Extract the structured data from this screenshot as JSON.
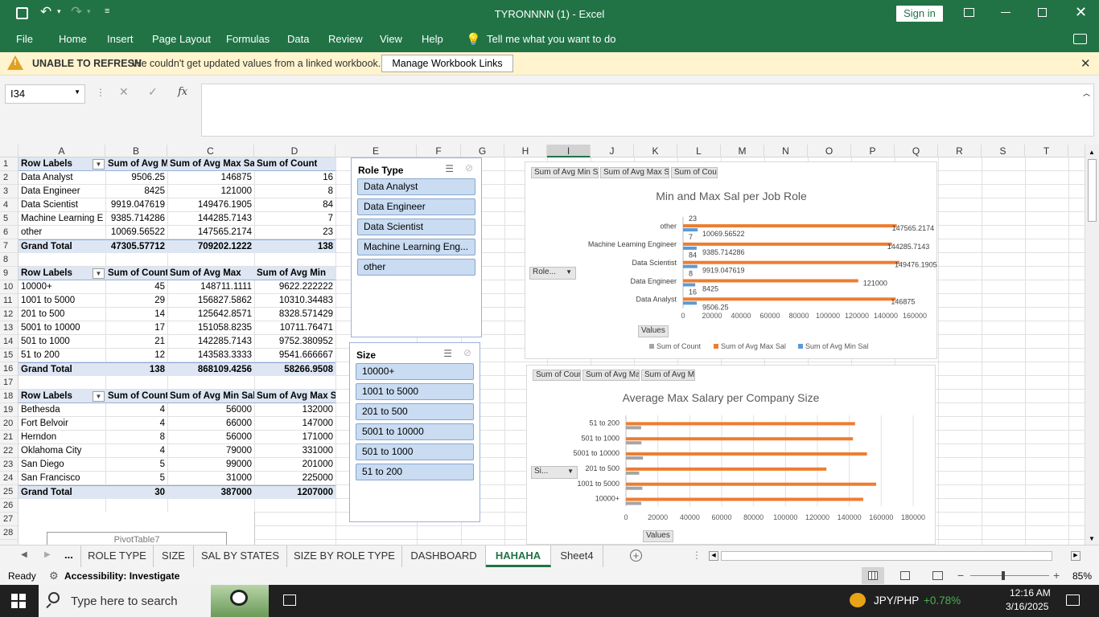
{
  "window": {
    "title": "TYRONNNN (1)  -  Excel",
    "sign_in": "Sign in"
  },
  "menu": [
    "File",
    "Home",
    "Insert",
    "Page Layout",
    "Formulas",
    "Data",
    "Review",
    "View",
    "Help"
  ],
  "tell_me": "Tell me what you want to do",
  "warning": {
    "title": "UNABLE TO REFRESH",
    "message": "We couldn't get updated values from a linked workbook.",
    "button": "Manage Workbook Links"
  },
  "formula": {
    "name_box": "I34",
    "fx": "fx",
    "value": ""
  },
  "columns": [
    "A",
    "B",
    "C",
    "D",
    "E",
    "F",
    "G",
    "H",
    "I",
    "J",
    "K",
    "L",
    "M",
    "N",
    "O",
    "P",
    "Q",
    "R",
    "S",
    "T"
  ],
  "rows": [
    "1",
    "2",
    "3",
    "4",
    "5",
    "6",
    "7",
    "8",
    "9",
    "10",
    "11",
    "12",
    "13",
    "14",
    "15",
    "16",
    "17",
    "18",
    "19",
    "20",
    "21",
    "22",
    "23",
    "24",
    "25",
    "26",
    "27",
    "28"
  ],
  "pivot1": {
    "headers": [
      "Row Labels",
      "Sum of Avg Mi",
      "Sum of Avg Max Sal",
      "Sum of Count"
    ],
    "rows": [
      [
        "Data Analyst",
        "9506.25",
        "146875",
        "16"
      ],
      [
        "Data Engineer",
        "8425",
        "121000",
        "8"
      ],
      [
        "Data Scientist",
        "9919.047619",
        "149476.1905",
        "84"
      ],
      [
        "Machine Learning E",
        "9385.714286",
        "144285.7143",
        "7"
      ],
      [
        "other",
        "10069.56522",
        "147565.2174",
        "23"
      ]
    ],
    "total": [
      "Grand Total",
      "47305.57712",
      "709202.1222",
      "138"
    ]
  },
  "pivot2": {
    "headers": [
      "Row Labels",
      "Sum of Count",
      "Sum of Avg Max",
      "Sum of Avg Min"
    ],
    "rows": [
      [
        "10000+",
        "45",
        "148711.1111",
        "9622.222222"
      ],
      [
        "1001 to 5000",
        "29",
        "156827.5862",
        "10310.34483"
      ],
      [
        "201 to 500",
        "14",
        "125642.8571",
        "8328.571429"
      ],
      [
        "5001 to 10000",
        "17",
        "151058.8235",
        "10711.76471"
      ],
      [
        "501 to 1000",
        "21",
        "142285.7143",
        "9752.380952"
      ],
      [
        "51 to 200",
        "12",
        "143583.3333",
        "9541.666667"
      ]
    ],
    "total": [
      "Grand Total",
      "138",
      "868109.4256",
      "58266.9508"
    ]
  },
  "pivot3": {
    "headers": [
      "Row Labels",
      "Sum of Count",
      "Sum of Avg Min Sal",
      "Sum of Avg Max Sal"
    ],
    "rows": [
      [
        "Bethesda",
        "4",
        "56000",
        "132000"
      ],
      [
        "Fort Belvoir",
        "4",
        "66000",
        "147000"
      ],
      [
        "Herndon",
        "8",
        "56000",
        "171000"
      ],
      [
        "Oklahoma City",
        "4",
        "79000",
        "331000"
      ],
      [
        "San Diego",
        "5",
        "99000",
        "201000"
      ],
      [
        "San Francisco",
        "5",
        "31000",
        "225000"
      ]
    ],
    "total": [
      "Grand Total",
      "30",
      "387000",
      "1207000"
    ]
  },
  "pivot_placeholder": "PivotTable7",
  "slicer_role": {
    "title": "Role Type",
    "items": [
      "Data Analyst",
      "Data Engineer",
      "Data Scientist",
      "Machine Learning Eng...",
      "other"
    ]
  },
  "slicer_size": {
    "title": "Size",
    "items": [
      "10000+",
      "1001 to 5000",
      "201 to 500",
      "5001 to 10000",
      "501 to 1000",
      "51 to 200"
    ]
  },
  "chart1": {
    "field_buttons": [
      "Sum of Avg Min Sal",
      "Sum of Avg Max Sal",
      "Sum of Count"
    ],
    "axis_button": "Role...",
    "values_button": "Values"
  },
  "chart2": {
    "field_buttons": [
      "Sum of Count",
      "Sum of Avg Max",
      "Sum of Avg Min"
    ],
    "axis_button": "Si...",
    "values_button": "Values"
  },
  "chart_data": [
    {
      "type": "bar",
      "orientation": "horizontal",
      "title": "Min and Max Sal per Job Role",
      "categories": [
        "other",
        "Machine Learning Engineer",
        "Data Scientist",
        "Data Engineer",
        "Data Analyst"
      ],
      "series": [
        {
          "name": "Sum of Count",
          "color": "#a5a5a5",
          "values": [
            23,
            7,
            84,
            8,
            16
          ],
          "labels": [
            "23",
            "7",
            "84",
            "8",
            "16"
          ]
        },
        {
          "name": "Sum of Avg Max Sal",
          "color": "#ed7d31",
          "values": [
            147565.2174,
            144285.7143,
            149476.1905,
            121000,
            146875
          ],
          "labels": [
            "147565.2174",
            "144285.7143",
            "149476.1905",
            "121000",
            "146875"
          ]
        },
        {
          "name": "Sum of Avg Min Sal",
          "color": "#5b9bd5",
          "values": [
            10069.56522,
            9385.714286,
            9919.047619,
            8425,
            9506.25
          ],
          "labels": [
            "10069.56522",
            "9385.714286",
            "9919.047619",
            "8425",
            "9506.25"
          ]
        }
      ],
      "xlim": [
        0,
        160000
      ],
      "ticks": [
        "0",
        "20000",
        "40000",
        "60000",
        "80000",
        "100000",
        "120000",
        "140000",
        "160000"
      ],
      "legend": "bottom"
    },
    {
      "type": "bar",
      "orientation": "horizontal",
      "title": "Average Max Salary per Company Size",
      "categories": [
        "51 to 200",
        "501 to 1000",
        "5001 to 10000",
        "201 to 500",
        "1001 to 5000",
        "10000+"
      ],
      "series": [
        {
          "name": "Sum of Count",
          "color": "#a5a5a5",
          "values": [
            12,
            21,
            17,
            14,
            29,
            45
          ]
        },
        {
          "name": "Sum of Avg Max",
          "color": "#ed7d31",
          "values": [
            143583.3333,
            142285.7143,
            151058.8235,
            125642.8571,
            156827.5862,
            148711.1111
          ]
        },
        {
          "name": "Sum of Avg Min",
          "color": "#a5a5a5",
          "values": [
            9541.666667,
            9752.380952,
            10711.76471,
            8328.571429,
            10310.34483,
            9622.222222
          ]
        }
      ],
      "xlim": [
        0,
        180000
      ],
      "ticks": [
        "0",
        "20000",
        "40000",
        "60000",
        "80000",
        "100000",
        "120000",
        "140000",
        "160000",
        "180000"
      ]
    }
  ],
  "tabs": [
    "ROLE TYPE",
    "SIZE",
    "SAL BY STATES",
    "SIZE BY ROLE TYPE",
    "DASHBOARD",
    "HAHAHA",
    "Sheet4"
  ],
  "active_tab": "HAHAHA",
  "status": {
    "ready": "Ready",
    "accessibility": "Accessibility: Investigate",
    "zoom": "85%"
  },
  "taskbar": {
    "search": "Type here to search",
    "ticker": "JPY/PHP",
    "change": "+0.78%",
    "time": "12:16 AM",
    "date": "3/16/2025"
  }
}
